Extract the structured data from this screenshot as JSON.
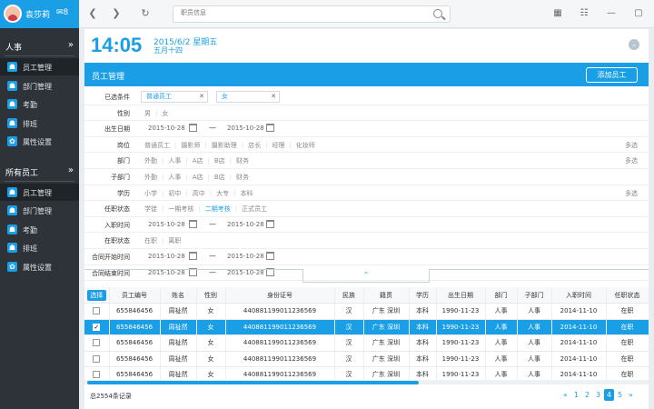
{
  "user": {
    "name": "袁莎莉",
    "mail_count": "8"
  },
  "sidebar": {
    "sections": [
      {
        "label": "人事",
        "arrow": "»",
        "items": [
          {
            "label": "员工管理",
            "active": true
          },
          {
            "label": "部门管理"
          },
          {
            "label": "考勤"
          },
          {
            "label": "排班"
          },
          {
            "label": "属性设置"
          }
        ]
      },
      {
        "label": "所有员工",
        "arrow": "»",
        "items": [
          {
            "label": "员工管理",
            "active": true
          },
          {
            "label": "部门管理"
          },
          {
            "label": "考勤"
          },
          {
            "label": "排班"
          },
          {
            "label": "属性设置"
          }
        ]
      }
    ]
  },
  "topbar": {
    "search_placeholder": "职员信息"
  },
  "header": {
    "time": "14:05",
    "date": "2015/6/2 星期五",
    "lunar": "五月十四"
  },
  "panel": {
    "title": "员工管理",
    "add_button": "添加员工"
  },
  "filters": {
    "selected_label": "已选条件",
    "chips": [
      "普通员工",
      "女"
    ],
    "gender": {
      "label": "性别",
      "options": [
        "男",
        "女"
      ]
    },
    "birth": {
      "label": "出生日期",
      "from": "2015-10-28",
      "to": "2015-10-28"
    },
    "position": {
      "label": "岗位",
      "options": [
        "普通员工",
        "摄影师",
        "摄影助理",
        "店长",
        "经理",
        "化妆师"
      ],
      "multi": "多选"
    },
    "dept": {
      "label": "部门",
      "options": [
        "外勤",
        "人事",
        "A店",
        "B店",
        "财务"
      ],
      "multi": "多选"
    },
    "subdept": {
      "label": "子部门",
      "options": [
        "外勤",
        "人事",
        "A店",
        "B店",
        "财务"
      ]
    },
    "edu": {
      "label": "学历",
      "options": [
        "小学",
        "初中",
        "高中",
        "大专",
        "本科"
      ],
      "multi": "多选"
    },
    "status": {
      "label": "任职状态",
      "options": [
        "学徒",
        "一期考核",
        "二期考核",
        "正式员工"
      ],
      "highlight": "二期考核"
    },
    "hire": {
      "label": "入职时间",
      "from": "2015-10-28",
      "to": "2015-10-28"
    },
    "work": {
      "label": "在职状态",
      "options": [
        "在职",
        "离职"
      ]
    },
    "contract_start": {
      "label": "合同开始时间",
      "from": "2015-10-28",
      "to": "2015-10-28"
    },
    "contract_end": {
      "label": "合同结束时间",
      "from": "2015-10-28",
      "to": "2015-10-28"
    },
    "dash": "—"
  },
  "table": {
    "headers": [
      "选择",
      "员工编号",
      "姓名",
      "性别",
      "身份证号",
      "民族",
      "籍贯",
      "学历",
      "出生日期",
      "部门",
      "子部门",
      "入职时间",
      "任职状态"
    ],
    "rows": [
      {
        "checked": false,
        "cells": [
          "655846456",
          "周祉然",
          "女",
          "440881199011236569",
          "汉",
          "广东 深圳",
          "本科",
          "1990-11-23",
          "人事",
          "人事",
          "2014-11-10",
          "在职"
        ]
      },
      {
        "checked": true,
        "cells": [
          "655846456",
          "周祉然",
          "女",
          "440881199011236569",
          "汉",
          "广东 深圳",
          "本科",
          "1990-11-23",
          "人事",
          "人事",
          "2014-11-10",
          "在职"
        ]
      },
      {
        "checked": false,
        "cells": [
          "655846456",
          "周祉然",
          "女",
          "440881199011236569",
          "汉",
          "广东 深圳",
          "本科",
          "1990-11-23",
          "人事",
          "人事",
          "2014-11-10",
          "在职"
        ]
      },
      {
        "checked": false,
        "cells": [
          "655846456",
          "周祉然",
          "女",
          "440881199011236569",
          "汉",
          "广东 深圳",
          "本科",
          "1990-11-23",
          "人事",
          "人事",
          "2014-11-10",
          "在职"
        ]
      },
      {
        "checked": false,
        "cells": [
          "655846456",
          "周祉然",
          "女",
          "440881199011236569",
          "汉",
          "广东 深圳",
          "本科",
          "1990-11-23",
          "人事",
          "人事",
          "2014-11-10",
          "在职"
        ]
      }
    ]
  },
  "footer": {
    "total": "总2554条记录",
    "pages": [
      "«",
      "1",
      "2",
      "3",
      "4",
      "5",
      "»"
    ],
    "current": "4"
  },
  "colors": {
    "accent": "#1a9ee6",
    "sidebar": "#2d3339"
  }
}
